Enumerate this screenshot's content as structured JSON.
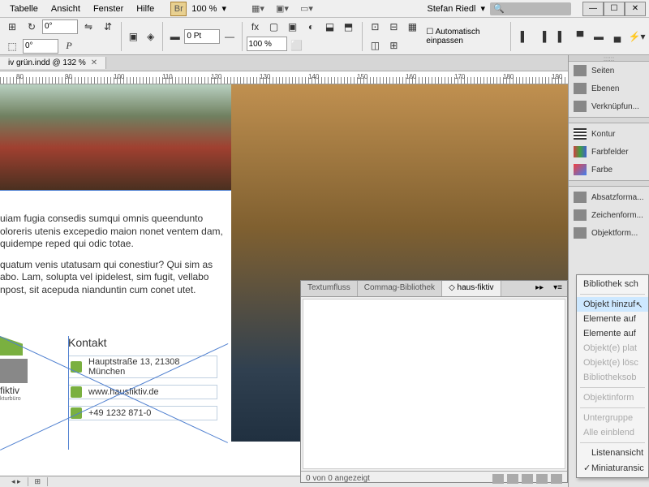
{
  "menu": [
    "Tabelle",
    "Ansicht",
    "Fenster",
    "Hilfe"
  ],
  "zoom": "100 %",
  "user": "Stefan Riedl",
  "doc_tab": "iv grün.indd @ 132 %",
  "ruler_marks": [
    80,
    90,
    100,
    110,
    120,
    130,
    140,
    150,
    160,
    170,
    180,
    190
  ],
  "toolbar": {
    "auto_fit": "Automatisch einpassen",
    "deg1": "0°",
    "deg2": "0°",
    "pt": "0 Pt"
  },
  "body_text": {
    "p1": "uiam fugia consedis sumqui omnis queendunto oloreris utenis excepedio maion nonet ventem dam, quidempe reped qui odic totae.",
    "p2": "quatum venis utatusam qui conestiur? Qui sim as abo. Lam, solupta vel ipidelest, sim fugit, vellabo npost, sit acepuda nianduntin cum conet utet."
  },
  "contact": {
    "title": "Kontakt",
    "logo": "fiktiv",
    "logo_sub": "kturbüro",
    "address": "Hauptstraße 13, 21308 München",
    "web": "www.hausfiktiv.de",
    "phone": "+49 1232 871-0"
  },
  "dock": {
    "seiten": "Seiten",
    "ebenen": "Ebenen",
    "verkn": "Verknüpfun...",
    "kontur": "Kontur",
    "farbfelder": "Farbfelder",
    "farbe": "Farbe",
    "absatz": "Absatzforma...",
    "zeichen": "Zeichenform...",
    "objekt": "Objektform..."
  },
  "panel": {
    "tab1": "Textumfluss",
    "tab2": "Commag-Bibliothek",
    "tab3": "◇ haus-fiktiv",
    "status": "0 von 0 angezeigt"
  },
  "context": {
    "i1": "Bibliothek sch",
    "i2": "Objekt hinzuf",
    "i3": "Elemente auf",
    "i4": "Elemente auf",
    "i5": "Objekt(e) plat",
    "i6": "Objekt(e) lösc",
    "i7": "Bibliotheksob",
    "i8": "Objektinform",
    "i9": "Untergruppe",
    "i10": "Alle einblend",
    "i11": "Listenansicht",
    "i12": "Miniaturansic"
  }
}
